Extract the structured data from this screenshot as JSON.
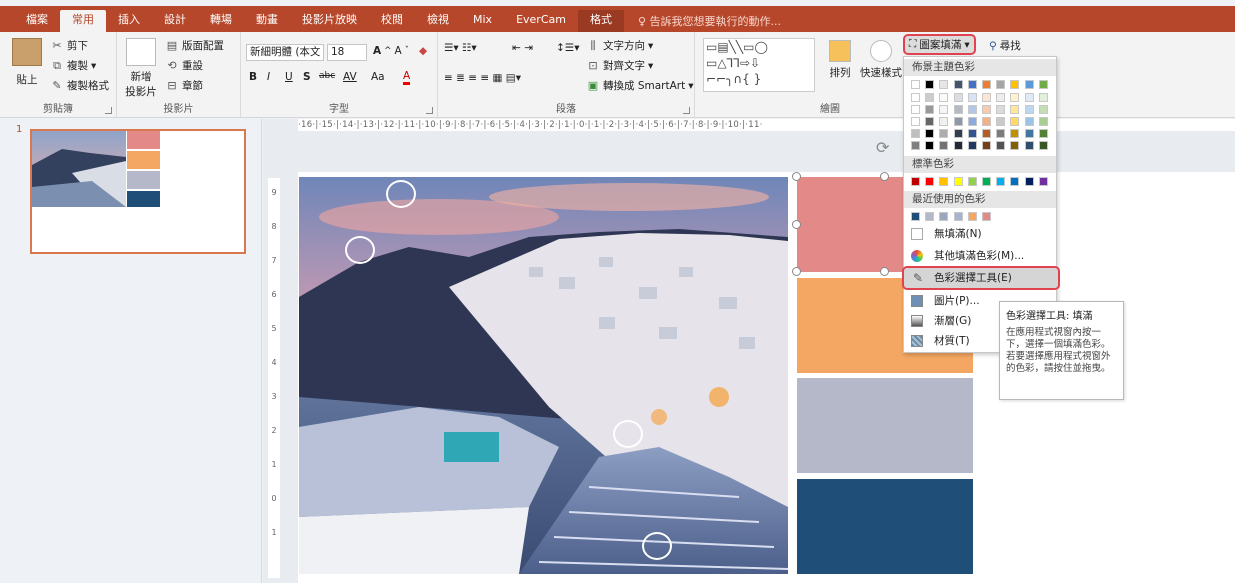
{
  "tabs": [
    "檔案",
    "常用",
    "插入",
    "設計",
    "轉場",
    "動畫",
    "投影片放映",
    "校閱",
    "檢視",
    "Mix",
    "EverCam",
    "格式"
  ],
  "active_tab": "常用",
  "tell_me": "告訴我您想要執行的動作...",
  "groups": {
    "clipboard": {
      "label": "剪貼簿",
      "paste": "貼上",
      "cut": "剪下",
      "copy": "複製",
      "format_painter": "複製格式"
    },
    "slides": {
      "label": "投影片",
      "new_slide_1": "新增",
      "new_slide_2": "投影片",
      "layout": "版面配置",
      "reset": "重設",
      "section": "章節"
    },
    "font": {
      "label": "字型",
      "font_name": "新細明體 (本文",
      "font_size": "18",
      "bold": "B",
      "italic": "I",
      "underline": "U",
      "shadow": "S",
      "strike": "abc",
      "spacing": "AV",
      "case": "Aa",
      "color": "A"
    },
    "paragraph": {
      "label": "段落",
      "text_direction": "文字方向",
      "align_text": "對齊文字",
      "smartart": "轉換成 SmartArt"
    },
    "drawing": {
      "label": "繪圖",
      "arrange": "排列",
      "quick_styles": "快速樣式",
      "shape_fill": "圖案填滿",
      "find": "尋找"
    }
  },
  "fill_dropdown": {
    "theme_colors_header": "佈景主題色彩",
    "standard_colors_header": "標準色彩",
    "recent_colors_header": "最近使用的色彩",
    "no_fill": "無填滿(N)",
    "more_colors": "其他填滿色彩(M)...",
    "eyedropper": "色彩選擇工具(E)",
    "picture": "圖片(P)...",
    "gradient": "漸層(G)",
    "texture": "材質(T)"
  },
  "theme_colors": [
    "#ffffff",
    "#000000",
    "#e7e6e6",
    "#44546a",
    "#4472c4",
    "#ed7d31",
    "#a5a5a5",
    "#ffc000",
    "#5b9bd5",
    "#70ad47"
  ],
  "standard_colors": [
    "#c00000",
    "#ff0000",
    "#ffc000",
    "#ffff00",
    "#92d050",
    "#00b050",
    "#00b0f0",
    "#0070c0",
    "#002060",
    "#7030a0"
  ],
  "recent_colors": [
    "#1f4e79",
    "#b4b8c9",
    "#9aa7bc",
    "#a8b3cf",
    "#f4a762",
    "#e38a89"
  ],
  "tooltip": {
    "title": "色彩選擇工具: 填滿",
    "body": "在應用程式視窗內按一下，選擇一個填滿色彩。若要選擇應用程式視窗外的色彩，請按住並拖曳。"
  },
  "slide_number": "1",
  "ruler_h": "·16·|·15·|·14·|·13·|·12·|·11·|·10·|·9·|·8·|·7·|·6·|·5·|·4·|·3·|·2·|·1·|·0·|·1·|·2·|·3·|·4·|·5·|·6·|·7·|·8·|·9·|·10·|·11·",
  "ruler_v": [
    "9",
    "8",
    "7",
    "6",
    "5",
    "4",
    "3",
    "2",
    "1",
    "0",
    "1"
  ],
  "palette_swatches": [
    "#e38a89",
    "#f4a762",
    "#b4b8c9",
    "#1f4e79"
  ]
}
